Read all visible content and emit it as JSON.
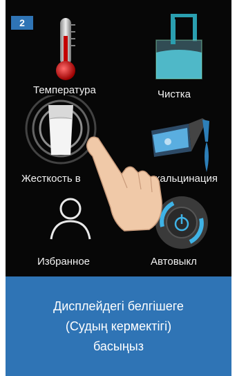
{
  "step": {
    "number": "2"
  },
  "menu": {
    "items": [
      {
        "label": "Температура",
        "icon": "thermometer-icon"
      },
      {
        "label": "Чистка",
        "icon": "cleaning-icon"
      },
      {
        "label": "Жесткость в",
        "icon": "water-hardness-icon"
      },
      {
        "label": "Декальцинация",
        "icon": "decalcification-icon"
      },
      {
        "label": "Избранное",
        "icon": "favorites-user-icon"
      },
      {
        "label": "Автовыкл",
        "icon": "auto-off-power-icon"
      }
    ]
  },
  "caption": {
    "lines": [
      "Дисплейдегі белгішеге",
      "(Судың кермектігі)",
      "басыңыз"
    ]
  },
  "colors": {
    "accent": "#2f74b5",
    "screen": "#070707",
    "highlight": "#3fb3e6"
  }
}
